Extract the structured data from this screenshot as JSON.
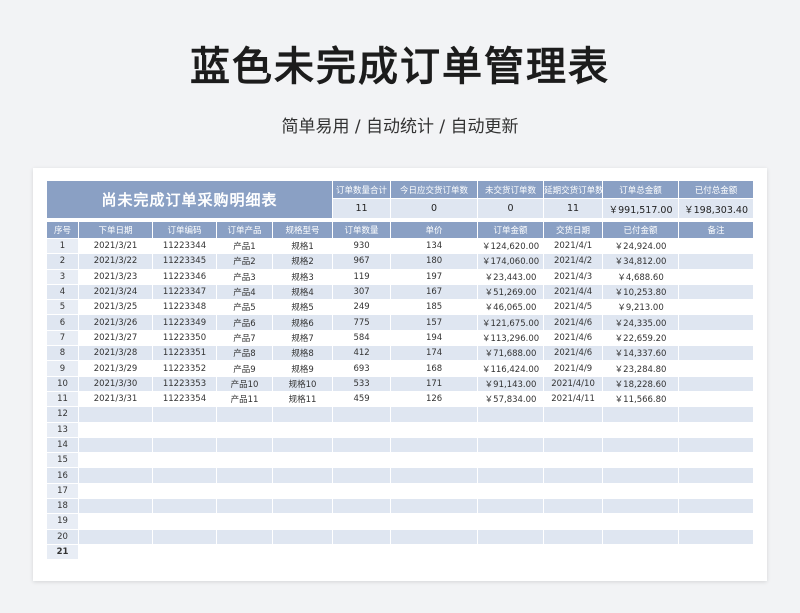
{
  "page": {
    "title": "蓝色未完成订单管理表",
    "subtitle": "简单易用 / 自动统计 / 自动更新"
  },
  "summary": {
    "table_title": "尚未完成订单采购明细表",
    "labels": [
      "订单数量合计",
      "今日应交货订单数",
      "未交货订单数",
      "延期交货订单数",
      "订单总金额",
      "已付总金额"
    ],
    "values": [
      "11",
      "0",
      "0",
      "11",
      "￥991,517.00",
      "￥198,303.40"
    ]
  },
  "columns": [
    "序号",
    "下单日期",
    "订单编码",
    "订单产品",
    "规格型号",
    "订单数量",
    "单价",
    "订单金额",
    "交货日期",
    "已付金额",
    "备注"
  ],
  "rows": [
    [
      "1",
      "2021/3/21",
      "11223344",
      "产品1",
      "规格1",
      "930",
      "134",
      "￥124,620.00",
      "2021/4/1",
      "￥24,924.00",
      ""
    ],
    [
      "2",
      "2021/3/22",
      "11223345",
      "产品2",
      "规格2",
      "967",
      "180",
      "￥174,060.00",
      "2021/4/2",
      "￥34,812.00",
      ""
    ],
    [
      "3",
      "2021/3/23",
      "11223346",
      "产品3",
      "规格3",
      "119",
      "197",
      "￥23,443.00",
      "2021/4/3",
      "￥4,688.60",
      ""
    ],
    [
      "4",
      "2021/3/24",
      "11223347",
      "产品4",
      "规格4",
      "307",
      "167",
      "￥51,269.00",
      "2021/4/4",
      "￥10,253.80",
      ""
    ],
    [
      "5",
      "2021/3/25",
      "11223348",
      "产品5",
      "规格5",
      "249",
      "185",
      "￥46,065.00",
      "2021/4/5",
      "￥9,213.00",
      ""
    ],
    [
      "6",
      "2021/3/26",
      "11223349",
      "产品6",
      "规格6",
      "775",
      "157",
      "￥121,675.00",
      "2021/4/6",
      "￥24,335.00",
      ""
    ],
    [
      "7",
      "2021/3/27",
      "11223350",
      "产品7",
      "规格7",
      "584",
      "194",
      "￥113,296.00",
      "2021/4/6",
      "￥22,659.20",
      ""
    ],
    [
      "8",
      "2021/3/28",
      "11223351",
      "产品8",
      "规格8",
      "412",
      "174",
      "￥71,688.00",
      "2021/4/6",
      "￥14,337.60",
      ""
    ],
    [
      "9",
      "2021/3/29",
      "11223352",
      "产品9",
      "规格9",
      "693",
      "168",
      "￥116,424.00",
      "2021/4/9",
      "￥23,284.80",
      ""
    ],
    [
      "10",
      "2021/3/30",
      "11223353",
      "产品10",
      "规格10",
      "533",
      "171",
      "￥91,143.00",
      "2021/4/10",
      "￥18,228.60",
      ""
    ],
    [
      "11",
      "2021/3/31",
      "11223354",
      "产品11",
      "规格11",
      "459",
      "126",
      "￥57,834.00",
      "2021/4/11",
      "￥11,566.80",
      ""
    ],
    [
      "12",
      "",
      "",
      "",
      "",
      "",
      "",
      "",
      "",
      "",
      ""
    ],
    [
      "13",
      "",
      "",
      "",
      "",
      "",
      "",
      "",
      "",
      "",
      ""
    ],
    [
      "14",
      "",
      "",
      "",
      "",
      "",
      "",
      "",
      "",
      "",
      ""
    ],
    [
      "15",
      "",
      "",
      "",
      "",
      "",
      "",
      "",
      "",
      "",
      ""
    ],
    [
      "16",
      "",
      "",
      "",
      "",
      "",
      "",
      "",
      "",
      "",
      ""
    ],
    [
      "17",
      "",
      "",
      "",
      "",
      "",
      "",
      "",
      "",
      "",
      ""
    ],
    [
      "18",
      "",
      "",
      "",
      "",
      "",
      "",
      "",
      "",
      "",
      ""
    ],
    [
      "19",
      "",
      "",
      "",
      "",
      "",
      "",
      "",
      "",
      "",
      ""
    ],
    [
      "20",
      "",
      "",
      "",
      "",
      "",
      "",
      "",
      "",
      "",
      ""
    ],
    [
      "21",
      "",
      "",
      "",
      "",
      "",
      "",
      "",
      "",
      "",
      ""
    ]
  ]
}
